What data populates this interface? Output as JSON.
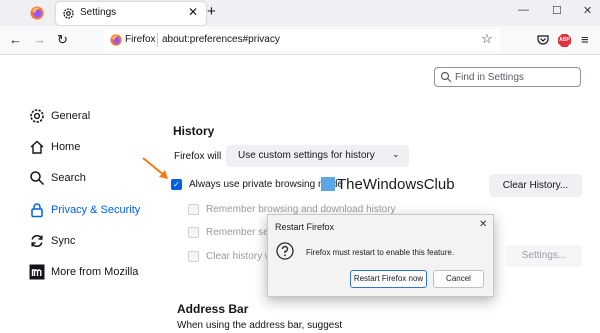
{
  "tabbar": {
    "tab_title": "Settings",
    "close_glyph": "✕",
    "newtab_glyph": "+",
    "window_controls": [
      "—",
      "☐",
      "✕"
    ]
  },
  "navbar": {
    "back": "←",
    "forward": "→",
    "reload": "↻",
    "identity": "Firefox",
    "url": "about:preferences#privacy",
    "bookmark_star": "☆",
    "abp_label": "ABP",
    "menu": "≡"
  },
  "search": {
    "placeholder": "Find in Settings"
  },
  "sidebar": {
    "items": [
      {
        "label": "General",
        "icon": "gear-icon"
      },
      {
        "label": "Home",
        "icon": "home-icon"
      },
      {
        "label": "Search",
        "icon": "search-icon"
      },
      {
        "label": "Privacy & Security",
        "icon": "lock-icon",
        "active": true
      },
      {
        "label": "Sync",
        "icon": "sync-icon"
      },
      {
        "label": "More from Mozilla",
        "icon": "mozilla-icon"
      }
    ]
  },
  "history": {
    "heading": "History",
    "will_label": "Firefox will",
    "select_value": "Use custom settings for history",
    "checkboxes": [
      {
        "label": "Always use private browsing mode",
        "checked": true,
        "disabled": false
      },
      {
        "label": "Remember browsing and download history",
        "checked": false,
        "disabled": true
      },
      {
        "label": "Remember sea",
        "checked": false,
        "disabled": true
      },
      {
        "label": "Clear history wh",
        "checked": false,
        "disabled": true
      }
    ],
    "clear_button": "Clear History...",
    "settings_button": "Settings..."
  },
  "watermark": "TheWindowsClub",
  "address_bar": {
    "heading": "Address Bar",
    "subtitle": "When using the address bar, suggest"
  },
  "dialog": {
    "title": "Restart Firefox",
    "close_glyph": "✕",
    "message": "Firefox must restart to enable this feature.",
    "restart_button": "Restart Firefox now",
    "cancel_button": "Cancel"
  },
  "colors": {
    "accent": "#0061e0",
    "arrow": "#f07c1a",
    "tabbar_bg": "#f0f0f4"
  }
}
